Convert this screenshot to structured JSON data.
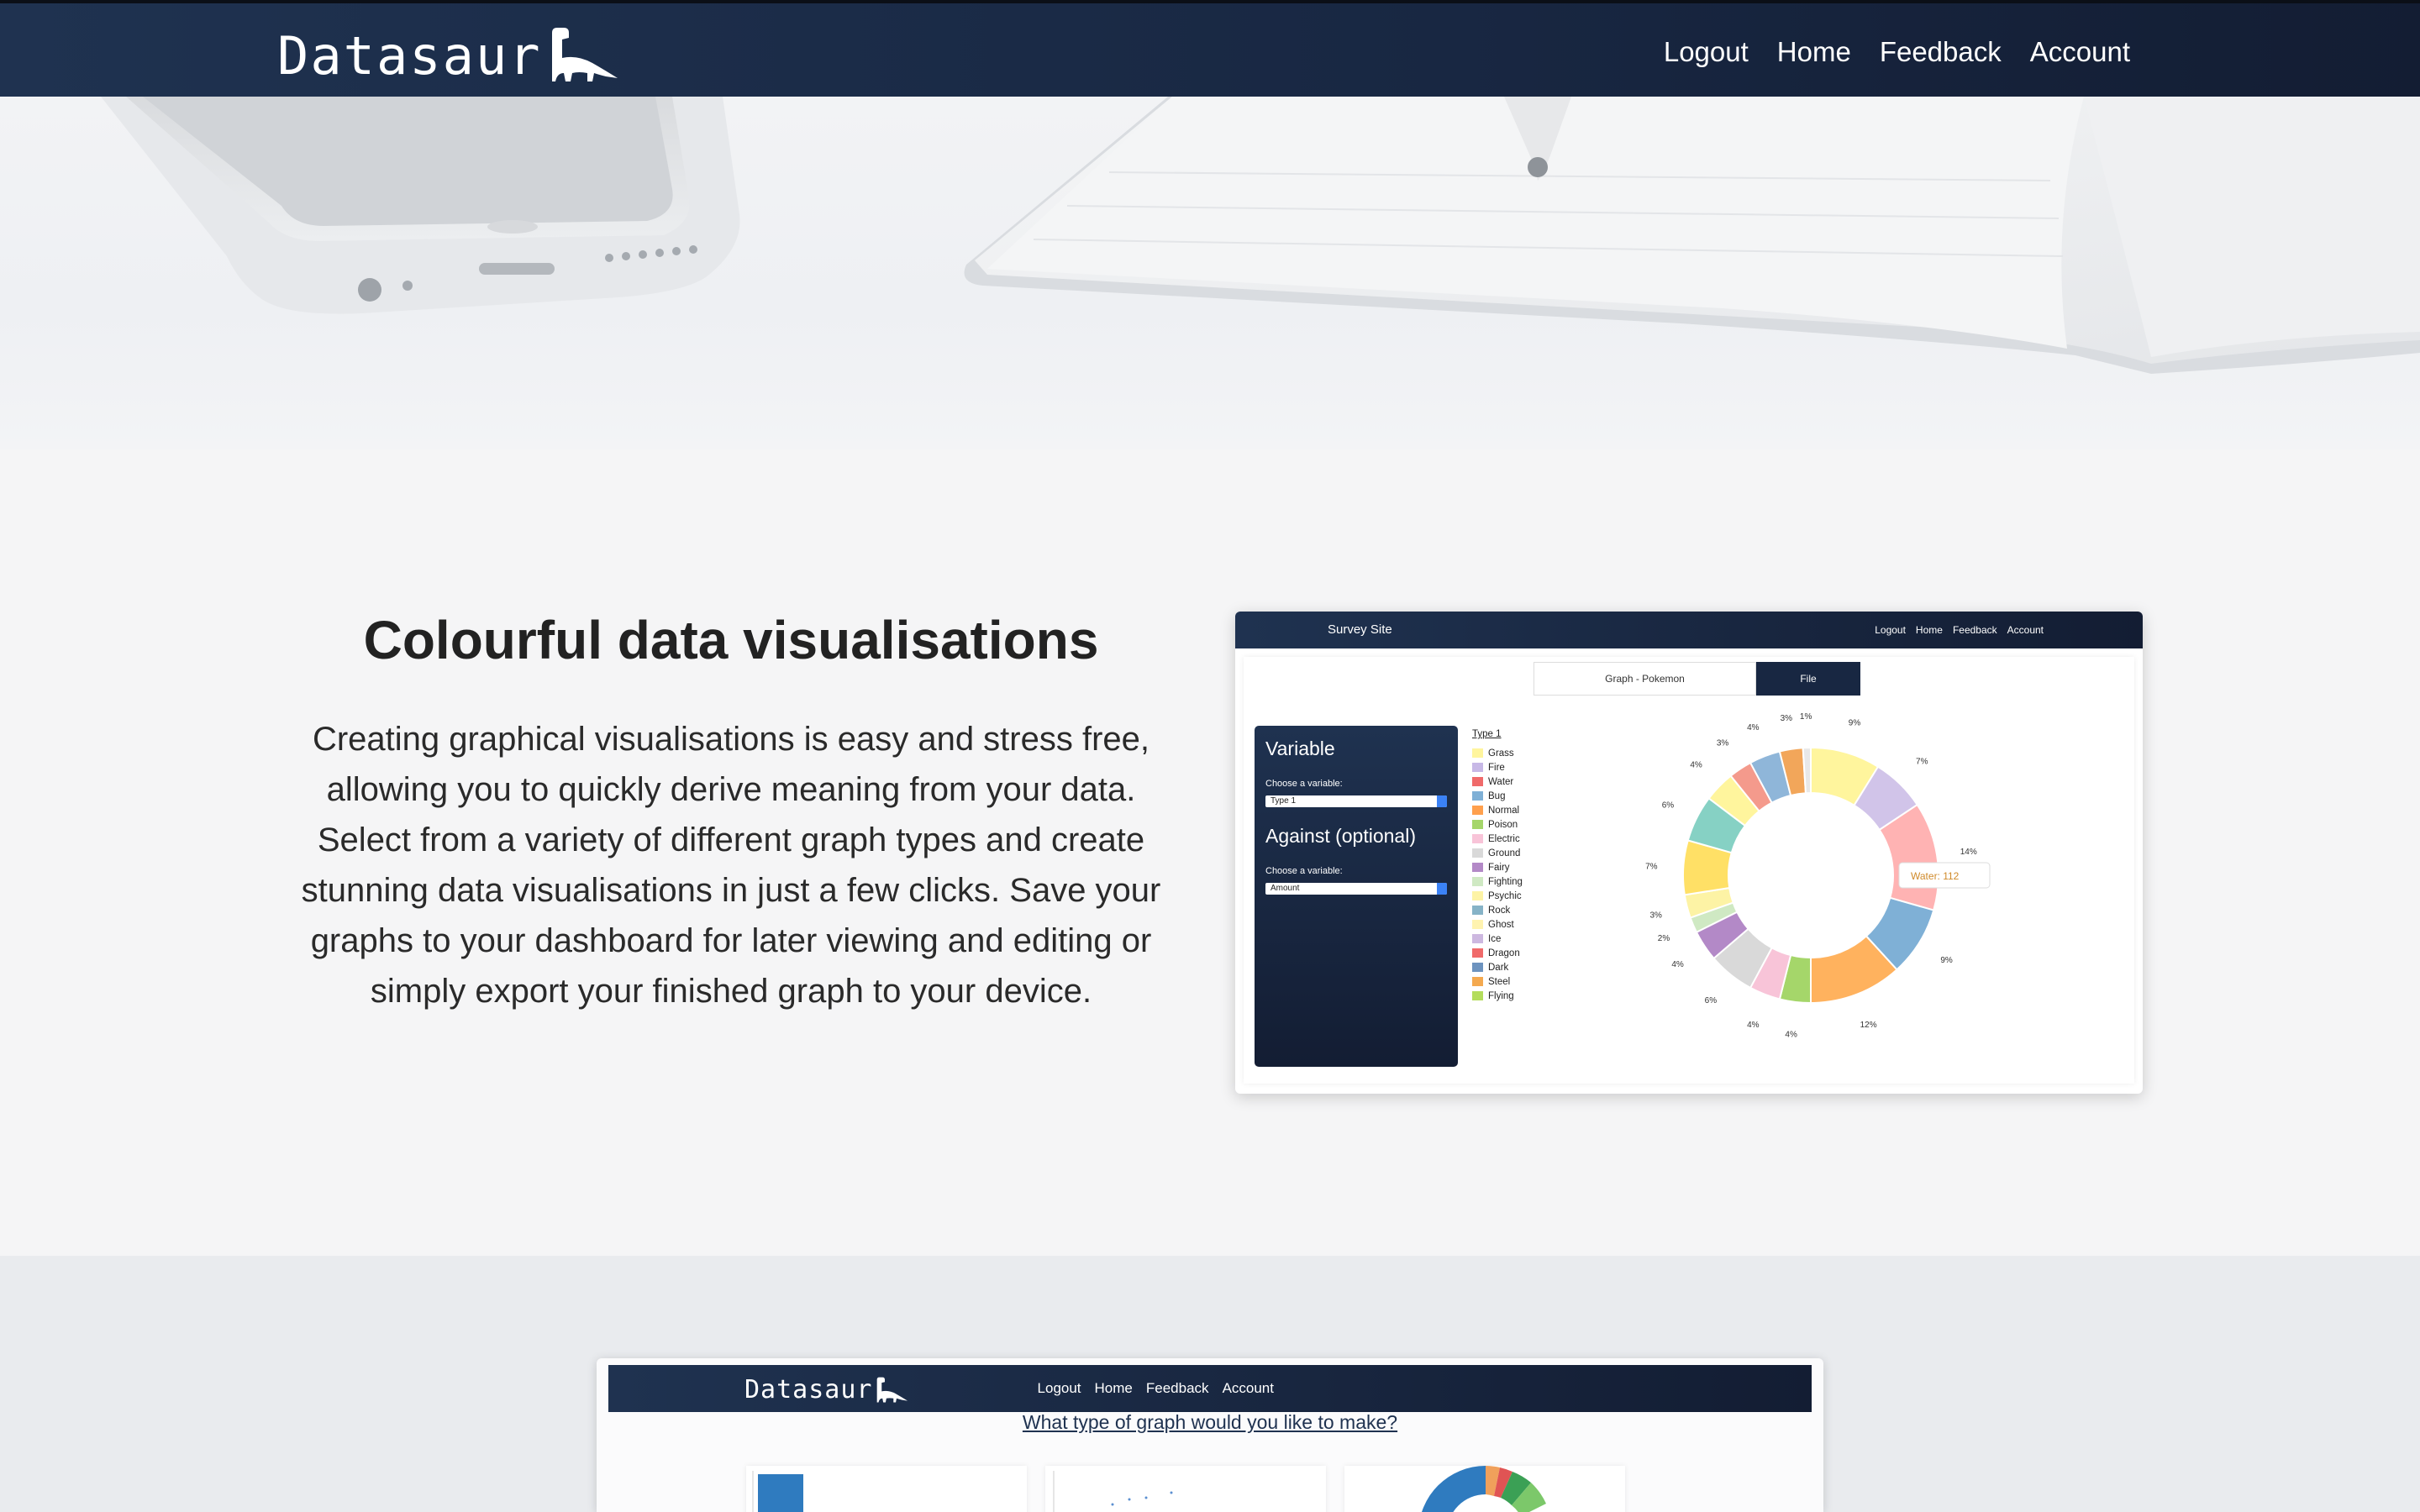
{
  "nav": {
    "brand": "Datasaur",
    "links": [
      "Logout",
      "Home",
      "Feedback",
      "Account"
    ]
  },
  "feature": {
    "title": "Colourful data visualisations",
    "body": "Creating graphical visualisations is easy and stress free, allowing you to quickly derive meaning from your data. Select from a variety of different graph types and create stunning data visualisations in just a few clicks. Save your graphs to your dashboard for later viewing and editing or simply export your finished graph to your device."
  },
  "preview1": {
    "site_title": "Survey Site",
    "links": [
      "Logout",
      "Home",
      "Feedback",
      "Account"
    ],
    "tabs": [
      "Graph - Pokemon",
      "File"
    ],
    "variable_heading": "Variable",
    "choose_label": "Choose a variable:",
    "variable_value": "Type 1",
    "against_heading": "Against (optional)",
    "choose_label2": "Choose a variable:",
    "against_value": "Amount",
    "tooltip": "Water: 112"
  },
  "chart_data": {
    "type": "pie",
    "title": "",
    "legend_title": "Type 1",
    "legend_position": "left",
    "categories": [
      "Grass",
      "Fire",
      "Water",
      "Bug",
      "Normal",
      "Poison",
      "Electric",
      "Ground",
      "Fairy",
      "Fighting",
      "Psychic",
      "Rock",
      "Ghost",
      "Ice",
      "Dragon",
      "Dark",
      "Steel",
      "Flying"
    ],
    "values": [
      9,
      7,
      14,
      9,
      12,
      4,
      4,
      6,
      4,
      2,
      3,
      7,
      6,
      4,
      3,
      4,
      3,
      1
    ],
    "labels": [
      "9%",
      "7%",
      "14%",
      "9%",
      "12%",
      "4%",
      "4%",
      "6%",
      "4%",
      "2%",
      "3%",
      "7%",
      "6%",
      "4%",
      "3%",
      "4%",
      "3%",
      "1%"
    ],
    "colors": [
      "#fff59d",
      "#d1c4e9",
      "#ffb3b3",
      "#7fb0d6",
      "#ffb25e",
      "#a5d66a",
      "#f8c4d8",
      "#d9d9d9",
      "#b389c7",
      "#cfe9c3",
      "#fdf3a5",
      "#ffe066",
      "#86d1c4",
      "#fff59d",
      "#f49a8c",
      "#8fb6d9",
      "#f2a65a",
      "#e8e8e8"
    ],
    "legend_colors": [
      "#fff59d",
      "#c7b8e6",
      "#f06a6a",
      "#7fb0d6",
      "#ffa04d",
      "#a5d66a",
      "#f8c4d8",
      "#d9d9d9",
      "#b389c7",
      "#cfe9c3",
      "#fdf3a5",
      "#86b3c7",
      "#fff3b0",
      "#cdb8e0",
      "#f06a6a",
      "#6d93bf",
      "#f4a94f",
      "#b4dd5c"
    ]
  },
  "preview2": {
    "brand": "Datasaur",
    "links": [
      "Logout",
      "Home",
      "Feedback",
      "Account"
    ],
    "question": "What type of graph would you like to make?"
  }
}
